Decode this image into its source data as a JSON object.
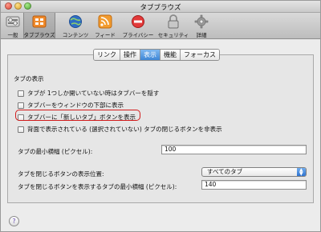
{
  "window": {
    "title": "タブブラウズ"
  },
  "toolbar": {
    "items": [
      {
        "label": "一般",
        "icon": "toggle-switch-icon"
      },
      {
        "label": "タブブラウズ",
        "icon": "tabs-grid-icon",
        "active": true
      },
      {
        "label": "コンテンツ",
        "icon": "globe-icon"
      },
      {
        "label": "フィード",
        "icon": "rss-icon"
      },
      {
        "label": "プライバシー",
        "icon": "no-entry-icon"
      },
      {
        "label": "セキュリティ",
        "icon": "lock-icon"
      },
      {
        "label": "詳細",
        "icon": "gear-icon"
      }
    ]
  },
  "tabs": [
    {
      "label": "リンク"
    },
    {
      "label": "操作"
    },
    {
      "label": "表示",
      "active": true
    },
    {
      "label": "機能"
    },
    {
      "label": "フォーカス"
    }
  ],
  "section_title": "タブの表示",
  "checkboxes": [
    {
      "label": "タブが 1つしか開いていない時はタブバーを隠す",
      "checked": false
    },
    {
      "label": "タブバーをウィンドウの下部に表示",
      "checked": false
    },
    {
      "label": "タブバーに「新しいタブ」ボタンを表示",
      "checked": false
    },
    {
      "label": "背面で表示されている (選択されていない) タブの閉じるボタンを非表示",
      "checked": false
    }
  ],
  "min_width": {
    "label": "タブの最小横幅 (ピクセル):",
    "value": "100"
  },
  "close_position": {
    "label": "タブを閉じるボタンの表示位置:",
    "value": "すべてのタブ"
  },
  "close_min_width": {
    "label": "タブを閉じるボタンを表示するタブの最小横幅 (ピクセル):",
    "value": "140"
  },
  "help": {
    "label": "?"
  },
  "colors": {
    "active_tab": "#3f87d6",
    "highlight": "#d11a1a",
    "help_glyph": "#6b4fb5"
  }
}
